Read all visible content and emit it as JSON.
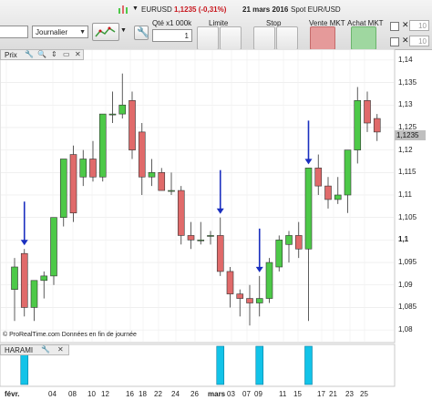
{
  "toolbar": {
    "instrument_name": "EURUSD",
    "instrument_quote": "1,1235 (-0,31%)",
    "instrument_date": "21 mars 2016",
    "market_label": "Spot EUR/USD",
    "period_value": "Journalier",
    "qty_label": "Qté x1 000k",
    "qty_value": "1",
    "limit_label": "Limite",
    "stop_label": "Stop",
    "sell_label": "Vente MKT",
    "buy_label": "Achat MKT",
    "box1_value": "10",
    "box2_value": "10",
    "accent_red": "#c8161d",
    "icons": [
      "search-icon",
      "wrench-icon",
      "chart-icon",
      "close-icon"
    ]
  },
  "price_panel": {
    "title": "Prix",
    "current_price": "1,1235",
    "y_ticks": [
      "1,14",
      "1,135",
      "1,13",
      "1,125",
      "1,12",
      "1,115",
      "1,11",
      "1,105",
      "1,1",
      "1,095",
      "1,09",
      "1,085",
      "1,08"
    ],
    "copyright": "© ProRealTime.com  Données en fin de journée"
  },
  "indicator_panel": {
    "title": "HARAMI"
  },
  "x_ticks": [
    "févr.",
    "04",
    "08",
    "10",
    "12",
    "16",
    "18",
    "22",
    "24",
    "26",
    "mars",
    "03",
    "07",
    "09",
    "11",
    "15",
    "17",
    "21",
    "23",
    "25"
  ],
  "chart_data": {
    "type": "candlestick",
    "ylim": [
      1.078,
      1.142
    ],
    "up_color": "#4dc948",
    "down_color": "#e06a6a",
    "candles": [
      {
        "o": 1.089,
        "h": 1.096,
        "l": 1.082,
        "c": 1.094
      },
      {
        "o": 1.097,
        "h": 1.098,
        "l": 1.083,
        "c": 1.085
      },
      {
        "o": 1.085,
        "h": 1.09,
        "l": 1.082,
        "c": 1.091
      },
      {
        "o": 1.091,
        "h": 1.093,
        "l": 1.087,
        "c": 1.092
      },
      {
        "o": 1.092,
        "h": 1.105,
        "l": 1.09,
        "c": 1.105
      },
      {
        "o": 1.105,
        "h": 1.118,
        "l": 1.103,
        "c": 1.118
      },
      {
        "o": 1.119,
        "h": 1.121,
        "l": 1.104,
        "c": 1.106
      },
      {
        "o": 1.114,
        "h": 1.12,
        "l": 1.112,
        "c": 1.118
      },
      {
        "o": 1.118,
        "h": 1.122,
        "l": 1.113,
        "c": 1.114
      },
      {
        "o": 1.114,
        "h": 1.128,
        "l": 1.113,
        "c": 1.128
      },
      {
        "o": 1.128,
        "h": 1.133,
        "l": 1.126,
        "c": 1.128
      },
      {
        "o": 1.128,
        "h": 1.137,
        "l": 1.127,
        "c": 1.13
      },
      {
        "o": 1.131,
        "h": 1.133,
        "l": 1.118,
        "c": 1.12
      },
      {
        "o": 1.124,
        "h": 1.126,
        "l": 1.11,
        "c": 1.114
      },
      {
        "o": 1.114,
        "h": 1.118,
        "l": 1.112,
        "c": 1.115
      },
      {
        "o": 1.115,
        "h": 1.116,
        "l": 1.111,
        "c": 1.111
      },
      {
        "o": 1.111,
        "h": 1.115,
        "l": 1.11,
        "c": 1.111
      },
      {
        "o": 1.111,
        "h": 1.112,
        "l": 1.099,
        "c": 1.101
      },
      {
        "o": 1.101,
        "h": 1.104,
        "l": 1.098,
        "c": 1.1
      },
      {
        "o": 1.1,
        "h": 1.104,
        "l": 1.099,
        "c": 1.1
      },
      {
        "o": 1.101,
        "h": 1.102,
        "l": 1.099,
        "c": 1.101
      },
      {
        "o": 1.101,
        "h": 1.105,
        "l": 1.092,
        "c": 1.093
      },
      {
        "o": 1.093,
        "h": 1.094,
        "l": 1.085,
        "c": 1.088
      },
      {
        "o": 1.088,
        "h": 1.089,
        "l": 1.083,
        "c": 1.087
      },
      {
        "o": 1.087,
        "h": 1.09,
        "l": 1.081,
        "c": 1.086
      },
      {
        "o": 1.086,
        "h": 1.092,
        "l": 1.083,
        "c": 1.087
      },
      {
        "o": 1.087,
        "h": 1.096,
        "l": 1.086,
        "c": 1.095
      },
      {
        "o": 1.094,
        "h": 1.101,
        "l": 1.093,
        "c": 1.1
      },
      {
        "o": 1.099,
        "h": 1.102,
        "l": 1.095,
        "c": 1.101
      },
      {
        "o": 1.101,
        "h": 1.104,
        "l": 1.096,
        "c": 1.098
      },
      {
        "o": 1.098,
        "h": 1.116,
        "l": 1.082,
        "c": 1.116
      },
      {
        "o": 1.116,
        "h": 1.119,
        "l": 1.11,
        "c": 1.112
      },
      {
        "o": 1.112,
        "h": 1.114,
        "l": 1.107,
        "c": 1.109
      },
      {
        "o": 1.109,
        "h": 1.114,
        "l": 1.108,
        "c": 1.11
      },
      {
        "o": 1.11,
        "h": 1.12,
        "l": 1.106,
        "c": 1.12
      },
      {
        "o": 1.12,
        "h": 1.134,
        "l": 1.117,
        "c": 1.131
      },
      {
        "o": 1.131,
        "h": 1.133,
        "l": 1.124,
        "c": 1.126
      },
      {
        "o": 1.127,
        "h": 1.128,
        "l": 1.122,
        "c": 1.124
      }
    ],
    "signal_markers": [
      1,
      21,
      25,
      30
    ],
    "harami_bars": [
      1,
      21,
      25,
      30
    ]
  }
}
